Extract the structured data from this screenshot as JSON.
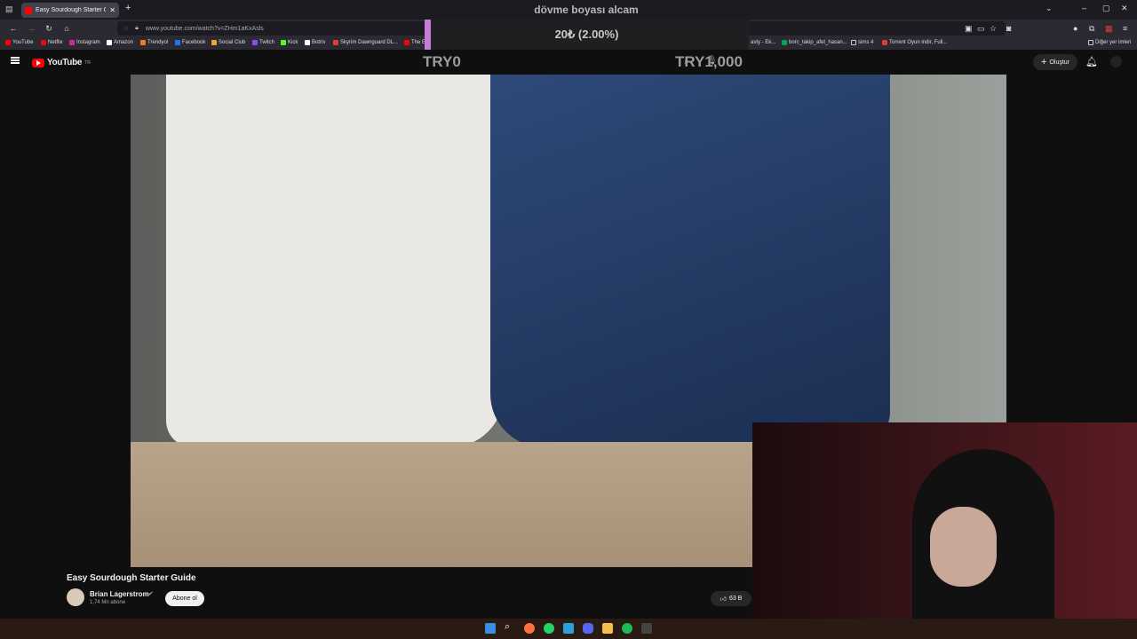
{
  "browser": {
    "tab_title": "Easy Sourdough Starter Guide",
    "url": "www.youtube.com/watch?v=ZHm1aKxAsls",
    "window_controls": [
      "–",
      "▢",
      "✕"
    ]
  },
  "bookmarks": [
    {
      "label": "YouTube",
      "color": "#ff0000"
    },
    {
      "label": "Netflix",
      "color": "#e50914"
    },
    {
      "label": "Instagram",
      "color": "#d6249f"
    },
    {
      "label": "Amazon",
      "color": "#ffffff"
    },
    {
      "label": "Trendyol",
      "color": "#f27a1a"
    },
    {
      "label": "Facebook",
      "color": "#1877f2"
    },
    {
      "label": "Social Club",
      "color": "#f5a623"
    },
    {
      "label": "Twitch",
      "color": "#9146ff"
    },
    {
      "label": "Kick",
      "color": "#53fc18"
    },
    {
      "label": "Botrix",
      "color": "#ffffff"
    },
    {
      "label": "Skyrim Dawnguard DL...",
      "color": "#e53935"
    },
    {
      "label": "The E",
      "color": "#ff0000"
    },
    {
      "label": "asty - Ek...",
      "color": "#888888"
    },
    {
      "label": "borc_takip_afet_hasan...",
      "color": "#0f9d58"
    },
    {
      "label": "sims 4",
      "color": "#cccccc"
    },
    {
      "label": "Torrent Oyun indir, Full...",
      "color": "#e53935"
    },
    {
      "label": "Diğer yer imleri",
      "color": "#cccccc"
    }
  ],
  "youtube": {
    "logo": "YouTube",
    "logo_region": "TR",
    "create_label": "Oluştur"
  },
  "overlay": {
    "title": "dövme boyası alcam",
    "progress": "20₺ (2.00%)",
    "progress_fraction": 0.02,
    "goal_start": "TRY0",
    "goal_end": "TRY1,000"
  },
  "video": {
    "title": "Easy Sourdough Starter Guide",
    "channel": "Brian Lagerstrom",
    "subscribers": "1,74 Mn abone",
    "subscribe_label": "Abone ol",
    "likes": "63 B"
  }
}
